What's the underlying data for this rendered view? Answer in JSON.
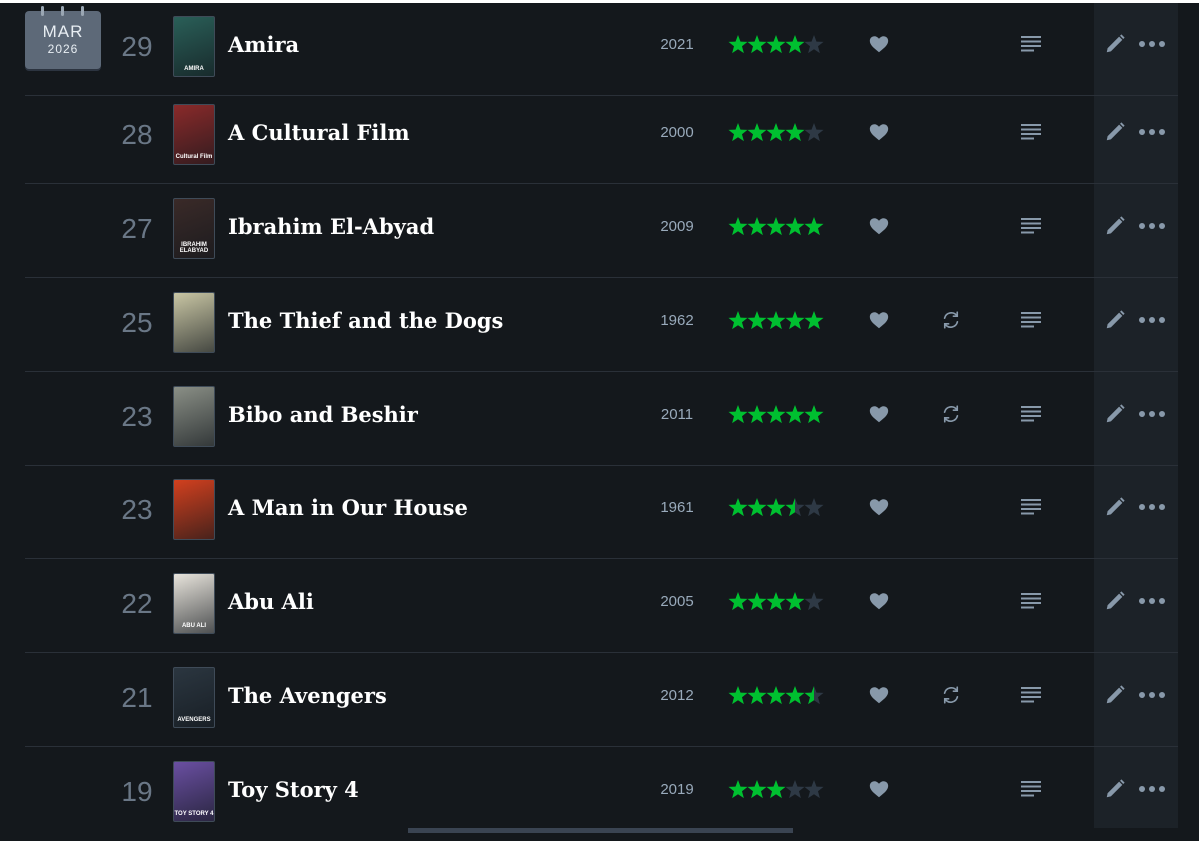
{
  "calendar": {
    "month": "MAR",
    "year": "2026"
  },
  "entries": [
    {
      "day": "29",
      "title": "Amira",
      "year": "2021",
      "rating": 4,
      "liked": true,
      "rewatch": false,
      "review": true,
      "poster_text": "AMIRA",
      "poster_color": "#2a5f58"
    },
    {
      "day": "28",
      "title": "A Cultural Film",
      "year": "2000",
      "rating": 4,
      "liked": true,
      "rewatch": false,
      "review": true,
      "poster_text": "Cultural Film",
      "poster_color": "#8a2a2a"
    },
    {
      "day": "27",
      "title": "Ibrahim El-Abyad",
      "year": "2009",
      "rating": 5,
      "liked": true,
      "rewatch": false,
      "review": true,
      "poster_text": "IBRAHIM ELABYAD",
      "poster_color": "#3a2a28"
    },
    {
      "day": "25",
      "title": "The Thief and the Dogs",
      "year": "1962",
      "rating": 5,
      "liked": true,
      "rewatch": true,
      "review": true,
      "poster_text": "",
      "poster_color": "#c9c6a4"
    },
    {
      "day": "23",
      "title": "Bibo and Beshir",
      "year": "2011",
      "rating": 5,
      "liked": true,
      "rewatch": true,
      "review": true,
      "poster_text": "",
      "poster_color": "#8a8f86"
    },
    {
      "day": "23",
      "title": "A Man in Our House",
      "year": "1961",
      "rating": 3.5,
      "liked": true,
      "rewatch": false,
      "review": true,
      "poster_text": "",
      "poster_color": "#d2401e"
    },
    {
      "day": "22",
      "title": "Abu Ali",
      "year": "2005",
      "rating": 4,
      "liked": true,
      "rewatch": false,
      "review": true,
      "poster_text": "ABU ALI",
      "poster_color": "#e8e4dc"
    },
    {
      "day": "21",
      "title": "The Avengers",
      "year": "2012",
      "rating": 4.5,
      "liked": true,
      "rewatch": true,
      "review": true,
      "poster_text": "AVENGERS",
      "poster_color": "#2b3640"
    },
    {
      "day": "19",
      "title": "Toy Story 4",
      "year": "2019",
      "rating": 3,
      "liked": true,
      "rewatch": false,
      "review": true,
      "poster_text": "TOY STORY 4",
      "poster_color": "#6a4fa2"
    }
  ],
  "colors": {
    "star_on": "#00c030",
    "star_off": "#2e3945",
    "icon": "#8899aa",
    "title": "#ffffff",
    "day": "#6a7786",
    "year": "#99aabb"
  },
  "icons": {
    "heart": "heart-icon",
    "rewatch": "rewatch-icon",
    "review": "review-lines-icon",
    "edit": "pencil-icon",
    "more": "more-dots-icon"
  }
}
